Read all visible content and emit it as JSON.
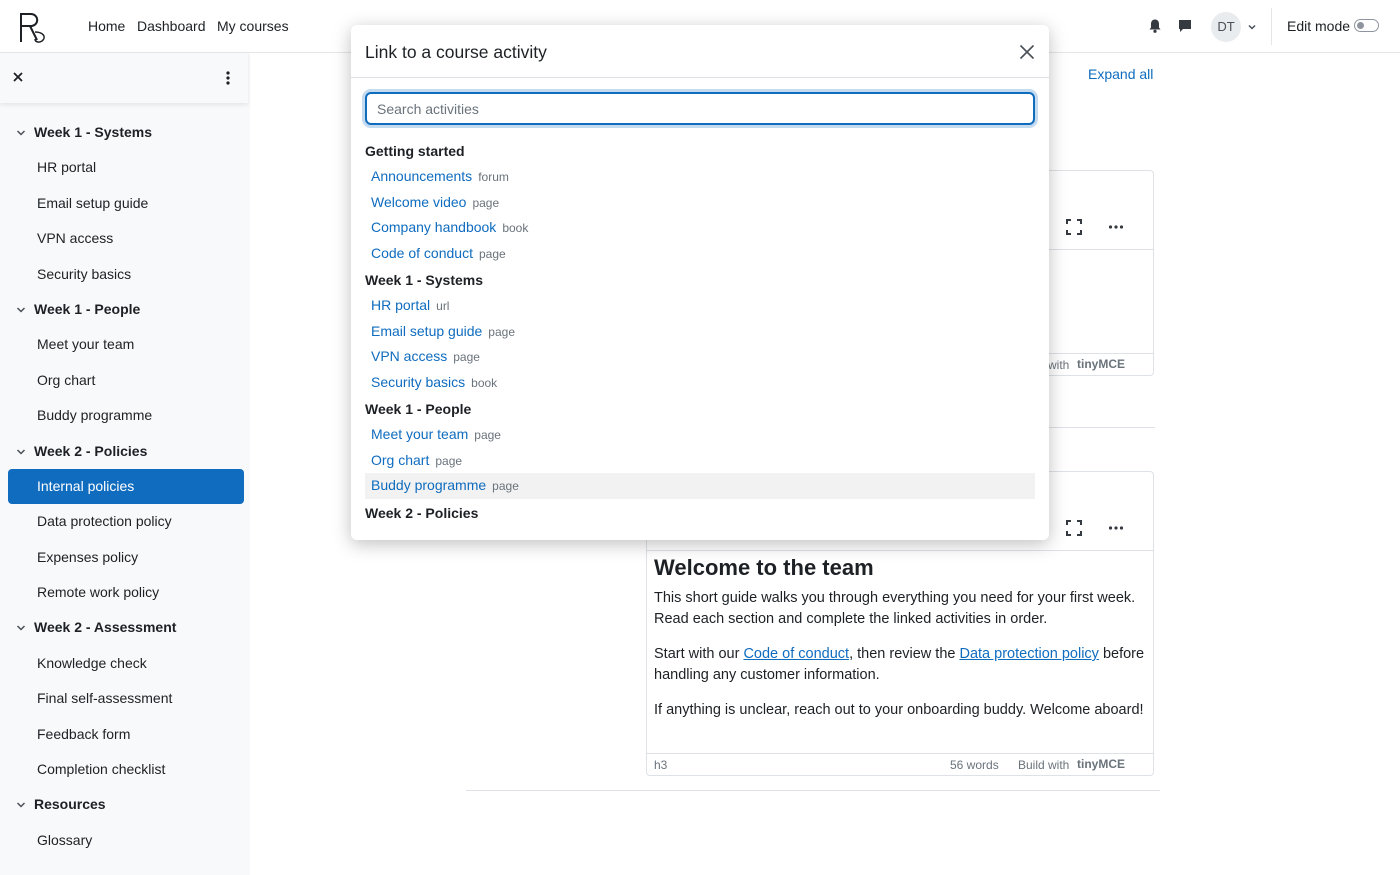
{
  "navbar": {
    "links": [
      "Home",
      "Dashboard",
      "My courses"
    ],
    "avatar_initials": "DT",
    "edit_mode_label": "Edit mode"
  },
  "drawer": {
    "sections": [
      {
        "title": "Week 1 - Systems",
        "items": [
          "HR portal",
          "Email setup guide",
          "VPN access",
          "Security basics"
        ]
      },
      {
        "title": "Week 1 - People",
        "items": [
          "Meet your team",
          "Org chart",
          "Buddy programme"
        ]
      },
      {
        "title": "Week 2 - Policies",
        "items": [
          "Internal policies",
          "Data protection policy",
          "Expenses policy",
          "Remote work policy"
        ]
      },
      {
        "title": "Week 2 - Assessment",
        "items": [
          "Knowledge check",
          "Final self-assessment",
          "Feedback form",
          "Completion checklist"
        ]
      },
      {
        "title": "Resources",
        "items": [
          "Glossary"
        ]
      }
    ],
    "active_item": "Internal policies"
  },
  "main": {
    "expand_all": "Expand all",
    "editor1": {
      "footer": "with"
    },
    "editor2": {
      "heading": "Welcome to the team",
      "p1": "This short guide walks you through everything you need for your first week. Read each section and complete the linked activities in order.",
      "p2_start": "Start with our ",
      "p2_link1": "Code of conduct",
      "p2_mid": ", then review the ",
      "p2_link2": "Data protection policy",
      "p2_end": " before handling any customer information.",
      "p3": "If anything is unclear, reach out to your onboarding buddy. Welcome aboard!",
      "path": "h3",
      "word_count": "56 words",
      "build_with": "Build with",
      "brand": "tinyMCE"
    }
  },
  "modal": {
    "title": "Link to a course activity",
    "search_placeholder": "Search activities",
    "groups": [
      {
        "title": "Getting started",
        "activities": [
          {
            "name": "Announcements",
            "type": "forum"
          },
          {
            "name": "Welcome video",
            "type": "page"
          },
          {
            "name": "Company handbook",
            "type": "book"
          },
          {
            "name": "Code of conduct",
            "type": "page"
          }
        ]
      },
      {
        "title": "Week 1 - Systems",
        "activities": [
          {
            "name": "HR portal",
            "type": "url"
          },
          {
            "name": "Email setup guide",
            "type": "page"
          },
          {
            "name": "VPN access",
            "type": "page"
          },
          {
            "name": "Security basics",
            "type": "book"
          }
        ]
      },
      {
        "title": "Week 1 - People",
        "activities": [
          {
            "name": "Meet your team",
            "type": "page"
          },
          {
            "name": "Org chart",
            "type": "page"
          },
          {
            "name": "Buddy programme",
            "type": "page"
          }
        ]
      },
      {
        "title": "Week 2 - Policies",
        "activities": []
      }
    ],
    "hovered_activity": "Buddy programme"
  },
  "colors": {
    "accent": "#0f6cbf",
    "drawer_bg": "#f8f9fa",
    "muted_text": "#6a737b"
  }
}
